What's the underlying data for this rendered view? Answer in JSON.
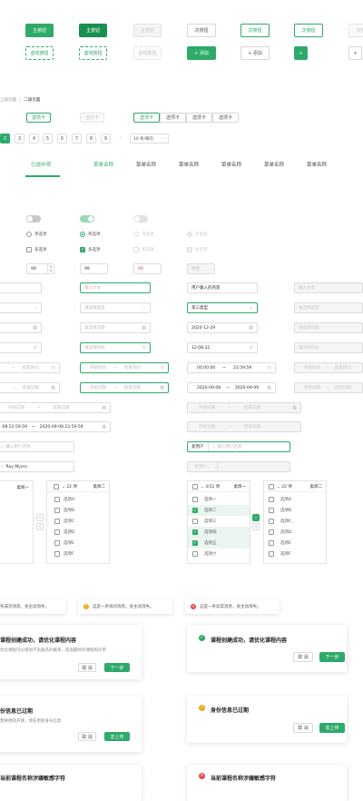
{
  "buttons_row1": [
    "主按钮",
    "主按钮",
    "主按钮",
    "次按钮",
    "次按钮",
    "次按钮",
    "次按钮"
  ],
  "buttons_row2": [
    "虚线按钮",
    "虚线按钮",
    "虚线按钮",
    "+ 添加",
    "+ 添加",
    "+",
    "+"
  ],
  "breadcrumb": {
    "first": "上级页面",
    "sep": "/",
    "second": "二级页面"
  },
  "chip_tabs": {
    "single": "选项卡",
    "single_disabled": "选项卡",
    "group": [
      "选项卡",
      "选项卡",
      "选项卡",
      "选项卡"
    ]
  },
  "pagination": {
    "pages": [
      "2",
      "3",
      "4",
      "5",
      "6",
      "7",
      "8",
      "9",
      "5"
    ],
    "page_size": "10 条/每页",
    "chevron": "⌄"
  },
  "menu": {
    "selected": "已选中项",
    "items": [
      "菜单名称",
      "菜单名称",
      "菜单名称",
      "菜单名称",
      "菜单名称",
      "菜单名称"
    ]
  },
  "radios": {
    "single": "单选项",
    "multi": "多选项"
  },
  "steppers": {
    "normal": "99",
    "plain": "99",
    "error": "99",
    "placeholder": "数量"
  },
  "inputs": {
    "left_col": [
      "",
      "",
      "",
      "",
      "",
      "",
      ""
    ],
    "mid_col": [
      "输入文本",
      "请选择类型",
      "请选择日期",
      "请选择时间"
    ],
    "right_col": [
      "用户输入的内容",
      "第三类型",
      "2020-12-29",
      "12:08:32"
    ],
    "far_right": [
      "输入文本",
      "请选择类型",
      "请选择日期",
      "请选择时间"
    ]
  },
  "time_ranges": {
    "mid": {
      "start": "开始时间",
      "sep": "~",
      "end": "结束时间"
    },
    "right": {
      "start": "00:00:00",
      "sep": "~",
      "end": "23:59:59"
    },
    "left_partial": {
      "sep": "~",
      "end": "结束时间"
    },
    "far": {
      "start": "开始时间",
      "sep": "~",
      "end": "结束时间"
    }
  },
  "date_ranges": {
    "mid": {
      "start": "开始日期",
      "sep": "~",
      "end": "结束日期"
    },
    "right": {
      "start": "2020-09-08",
      "sep": "~",
      "end": "2020-09-09"
    },
    "left_partial": {
      "sep": "~",
      "end": "结束日期"
    },
    "far": {
      "start": "开始日期",
      "sep": "~",
      "end": "结束日期"
    },
    "left2": {
      "start": "开始日期",
      "sep": "~",
      "end": "结束日期"
    },
    "right2": {
      "start": "开始日期",
      "sep": "~",
      "end": "结束日期"
    }
  },
  "datetime_range": {
    "start": "-08 23:59:59",
    "sep": "~",
    "end": "2020-09-08 23:59:59"
  },
  "search": {
    "left_placeholder": "输入用户名称",
    "prefix": "新用户",
    "right_placeholder": "输入用户名称",
    "left_value": "Ray Myers",
    "prefix2": "新用户"
  },
  "transfer_left": {
    "header_left": "类目一",
    "right_header": "22 项",
    "right_header_right": "类目二",
    "items": [
      "选项A",
      "选项B",
      "选项C",
      "选项D",
      "选项E",
      "选项F"
    ]
  },
  "transfer_right": {
    "header_left": "3/12 项",
    "header_right": "类目一",
    "items": [
      "选项一",
      "选项二",
      "选项三",
      "选项四",
      "选项五",
      "选项六"
    ],
    "checked": [
      false,
      true,
      false,
      true,
      true,
      false
    ],
    "right_header": "22 项",
    "right_header_right": "类目二",
    "right_items": [
      "选项A",
      "选项B",
      "选项C",
      "选项D",
      "选项E",
      "选项F"
    ]
  },
  "messages": [
    {
      "text": "条成功消息，会主动消失。",
      "type": "success"
    },
    {
      "text": "这是一条询问消息，会主动消失。",
      "type": "warning"
    },
    {
      "text": "这是一条异常消息，会主动消失。",
      "type": "error"
    }
  ],
  "cards": {
    "c1": {
      "title": "课程创建成功，请优化课程内容",
      "desc": "优化课程可以增加学员报名的概率，提高最终的课程购买率",
      "cancel": "取 消",
      "ok": "下一步"
    },
    "c2": {
      "title": "课程创建成功，请优化课程内容",
      "cancel": "取 消",
      "ok": "下一步"
    },
    "c3": {
      "title": "份信息已过期",
      "desc": "需要继续开课，请先更新身份信息",
      "cancel": "取 消",
      "ok": "去上传"
    },
    "c4": {
      "title": "身份信息已过期",
      "cancel": "取 消",
      "ok": "去上传"
    },
    "c5": {
      "title": "当前课程名称涉嫌敏感字符"
    },
    "c6": {
      "title": "当前课程名称涉嫌敏感字符"
    }
  },
  "colors": {
    "brand": "#2eaa6a",
    "dark": "#18904f",
    "warning": "#f5a623",
    "error": "#e5484d"
  }
}
